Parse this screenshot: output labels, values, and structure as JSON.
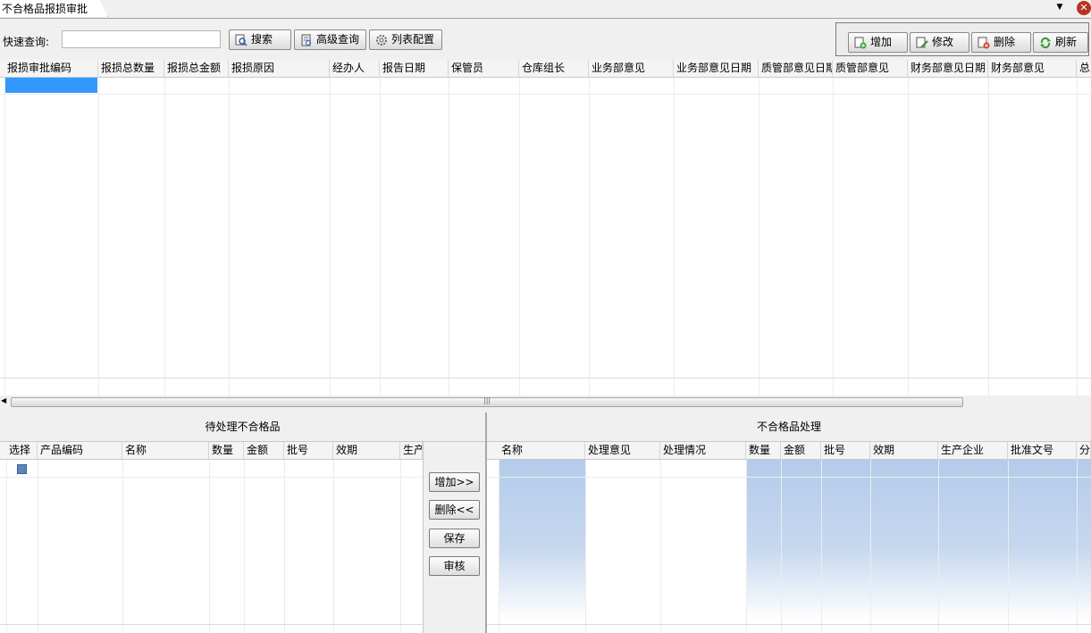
{
  "tab": {
    "title": "不合格品报损审批"
  },
  "icons": {
    "dropdown": "▼",
    "close": "✕"
  },
  "search": {
    "label": "快速查询:",
    "value": "",
    "placeholder": ""
  },
  "toolbar": {
    "search_btn": "搜索",
    "advanced_btn": "高级查询",
    "config_btn": "列表配置",
    "add_btn": "增加",
    "edit_btn": "修改",
    "delete_btn": "删除",
    "refresh_btn": "刷新"
  },
  "main_grid": {
    "columns": [
      "报损审批编码",
      "报损总数量",
      "报损总金额",
      "报损原因",
      "经办人",
      "报告日期",
      "保管员",
      "仓库组长",
      "业务部意见",
      "业务部意见日期",
      "质管部意见日期",
      "质管部意见",
      "财务部意见日期",
      "财务部意见",
      "总"
    ]
  },
  "pending": {
    "title": "待处理不合格品",
    "columns": [
      "选择",
      "产品编码",
      "名称",
      "数量",
      "金额",
      "批号",
      "效期",
      "生产"
    ]
  },
  "middle_buttons": {
    "add": "增加>>",
    "delete": "删除<<",
    "save": "保存",
    "audit": "审核"
  },
  "processing": {
    "title": "不合格品处理",
    "columns": [
      "名称",
      "处理意见",
      "处理情况",
      "数量",
      "金额",
      "批号",
      "效期",
      "生产企业",
      "批准文号",
      "分"
    ]
  },
  "colors": {
    "selected_cell": "#3399ff",
    "accent_blue": "#b3cbea",
    "close": "#b8341f"
  }
}
